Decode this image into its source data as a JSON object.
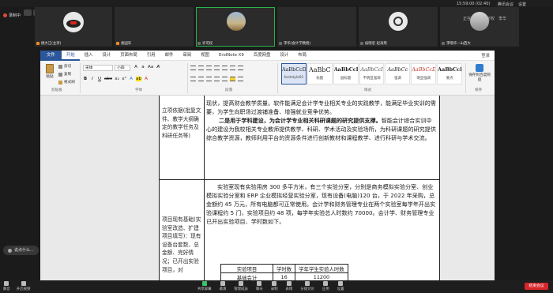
{
  "meeting": {
    "recording_label": "录制中",
    "timer": "15:59:00 (02:40)",
    "top_right_items": [
      "腾讯会议",
      "设置"
    ],
    "share_info": [
      "正在共享",
      "许可权",
      "李华"
    ],
    "leave_button": "结束会议",
    "chat_toast": "说点什么..."
  },
  "participants": [
    {
      "name": "杨大江(主持)"
    },
    {
      "name": "袁国军"
    },
    {
      "name": "许可权"
    },
    {
      "name": "李华(会计学教授)"
    },
    {
      "name": "侯晓宏 赵海燕"
    },
    {
      "name": "李晓华—山西大"
    }
  ],
  "word": {
    "tabs": [
      "文件",
      "开始",
      "插入",
      "设计",
      "页面布局",
      "引用",
      "邮件",
      "审阅",
      "视图",
      "EndNote X9",
      "百度网盘",
      "设计",
      "布局"
    ],
    "login": "登录",
    "paste_label": "粘贴",
    "cut_label": "剪切",
    "copy_label": "复制",
    "format_painter_label": "格式刷",
    "font_name": "宋体",
    "font_size": "小四",
    "group_labels": {
      "clipboard": "剪贴板",
      "font": "字体",
      "paragraph": "段落",
      "styles": "样式",
      "save": "保存"
    },
    "styles": [
      {
        "preview": "AaBbCcDc",
        "name": "fontstyle01"
      },
      {
        "preview": "AaBbC",
        "name": "标题"
      },
      {
        "preview": "AaBbCcI",
        "name": "副标题"
      },
      {
        "preview": "AaBbCcI",
        "name": "不明显强调"
      },
      {
        "preview": "AaBbCc",
        "name": "强调"
      },
      {
        "preview": "AaBbCcDc",
        "name": "明显强调"
      },
      {
        "preview": "AaBbCcD",
        "name": "要点"
      }
    ],
    "save_label": "保存到百度网盘"
  },
  "document": {
    "row1_left": "立项依据(批复文件、教学大纲确定的教学任务及科研任务等)",
    "row1_right_intro": "现状，提高财会教学质量。软件能满足会计学专业相关专业的实践教学，能满足毕业实训的需要，为学生向职场过渡铺准备、增强就业竞争优势。",
    "row1_right_bold": "二是用于学科建设，为会计学专业相关科研课题的研究提供支撑。",
    "row1_right_rest": "智能会计综合实训中心的建设为我校相关专业教师提供教学、科研、学术活动及实验场所，为科研课题的研究提供综合教学资源，教师利用平台的资源条件进行创新教材和课程教学、进行科研与学术交流。",
    "row2_left": "项目现有基础(实验室改造、扩建项目填写)：现有设备台套数、总金额、完好情况；已开出实验项目，对",
    "row2_right": "实验室现有实验用房 300 多平方米，有三个实验分室，分别是商务模拟实验分室、创业模拟实验分室和 ERP 企业模拟经营实验分室，现有设备(电脑)120 台，于 2022 年采购，总金额约 45 万元，所有电脑都可正常使用。会计学和财务管理专业在两个实验室每学年开出实验课程约 5 门，实验项目约 48 项，每学年实验总人时数约 70000。会计学、财务管理专业已开出实验项目、学时数如下。",
    "table_headers": [
      "实验项目",
      "学时数",
      "学年学生实验人时数"
    ],
    "table_rows": [
      [
        "基础会计",
        "16",
        "11200"
      ]
    ]
  },
  "toolbar": {
    "left": [
      "静音",
      "开启视频"
    ],
    "center": [
      "共享屏幕",
      "邀请",
      "管理成员",
      "聊天",
      "录制",
      "表情",
      "分组讨论",
      "应用",
      "设置"
    ]
  },
  "colors": {
    "word_blue": "#2b579a",
    "leave_red": "#d7262b",
    "active_green": "#28b24b",
    "rec_red": "#e0493c"
  }
}
